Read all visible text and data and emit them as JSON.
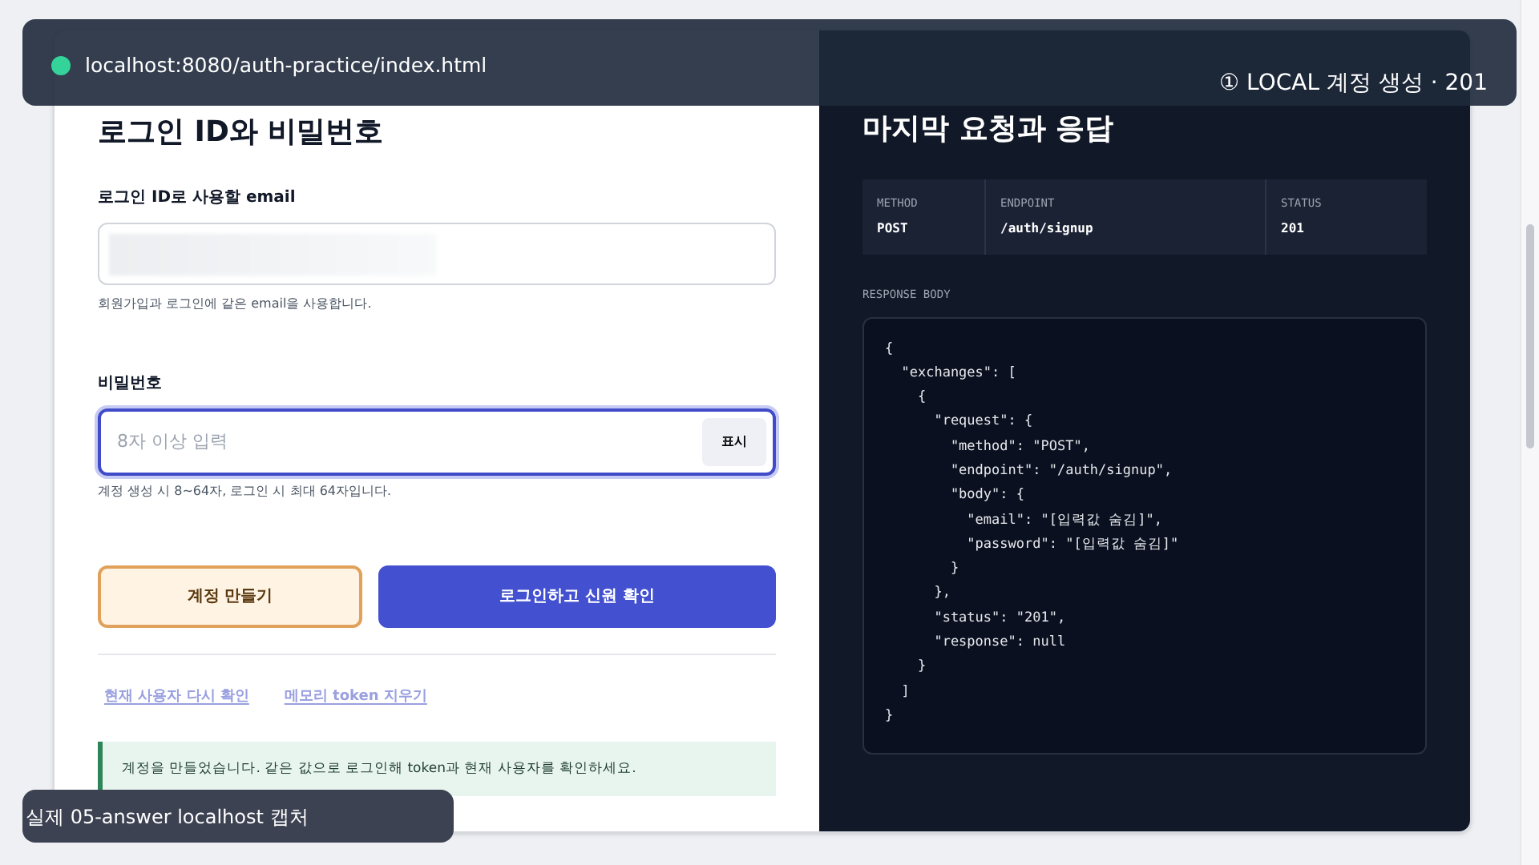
{
  "top_bar": {
    "url": "localhost:8080/auth-practice/index.html",
    "step": "① LOCAL 계정 생성 · 201"
  },
  "form": {
    "title": "로그인 ID와 비밀번호",
    "email": {
      "label": "로그인 ID로 사용할 email",
      "help": "회원가입과 로그인에 같은 email을 사용합니다.",
      "focused": false
    },
    "password": {
      "label": "비밀번호",
      "placeholder": "8자 이상 입력",
      "toggle": "표시",
      "help": "계정 생성 시 8~64자, 로그인 시 최대 64자입니다.",
      "focused": true
    },
    "buttons": [
      {
        "label": "계정 만들기",
        "kind": "secondary"
      },
      {
        "label": "로그인하고 신원 확인",
        "kind": "primary"
      }
    ],
    "links": [
      "현재 사용자 다시 확인",
      "메모리 token 지우기"
    ],
    "message": "계정을 만들었습니다. 같은 값으로 로그인해 token과 현재 사용자를 확인하세요."
  },
  "evidence": {
    "title": "마지막 요청과 응답",
    "fields": [
      {
        "label": "METHOD",
        "value": "POST"
      },
      {
        "label": "ENDPOINT",
        "value": "/auth/signup"
      },
      {
        "label": "STATUS",
        "value": "201"
      }
    ],
    "body_label": "RESPONSE BODY",
    "body_lines": [
      "{",
      "  \"exchanges\": [",
      "    {",
      "      \"request\": {",
      "        \"method\": \"POST\",",
      "        \"endpoint\": \"/auth/signup\",",
      "        \"body\": {",
      "          \"email\": \"[입력값 숨김]\",",
      "          \"password\": \"[입력값 숨김]\"",
      "        }",
      "      },",
      "      \"status\": \"201\",",
      "      \"response\": null",
      "    }",
      "  ]",
      "}"
    ]
  },
  "caption": "실제 05-answer localhost 캡처"
}
